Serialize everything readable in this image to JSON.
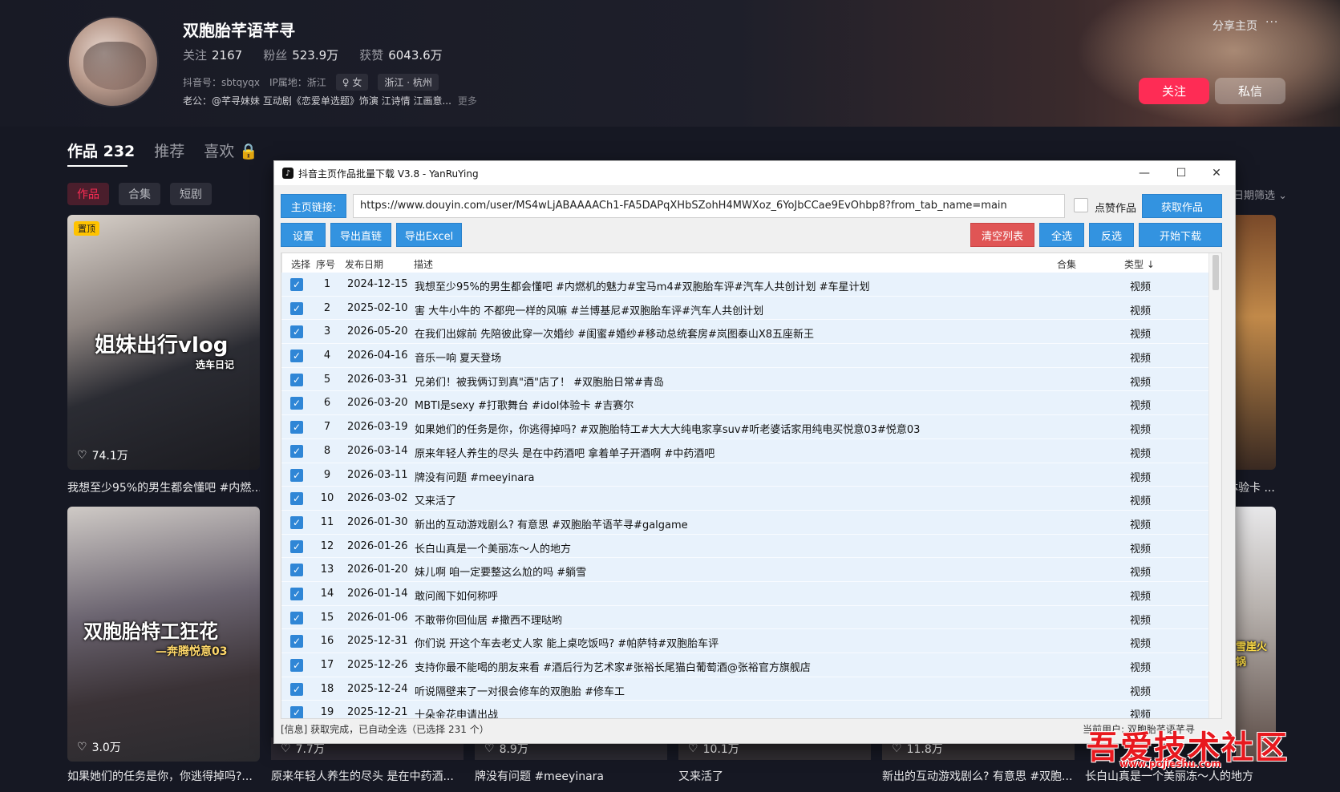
{
  "profile": {
    "name": "双胞胎芊语芊寻",
    "follow_label": "关注",
    "follow_count": "2167",
    "fans_label": "粉丝",
    "fans_count": "523.9万",
    "likes_label": "获赞",
    "likes_count": "6043.6万",
    "douyin_id": "抖音号：sbtqyqx",
    "ip": "IP属地：浙江",
    "gender_tag": "♀ 女",
    "location_tag": "浙江 · 杭州",
    "bio": "老公：@芊寻妹妹 互动剧《恋爱单选题》饰演 江诗情 江画意...",
    "bio_more": "更多",
    "share": "分享主页",
    "more_dots": "···",
    "follow_btn": "关注",
    "message_btn": "私信"
  },
  "tabs": {
    "works": "作品 232",
    "recommend": "推荐",
    "favorites": "喜欢 🔒",
    "sub": [
      "作品",
      "合集",
      "短剧"
    ],
    "date_filter": "日期筛选 ⌄"
  },
  "cards": [
    {
      "likes": "74.1万",
      "title": "我想至少95%的男生都会懂吧 #内燃...",
      "pin": "置顶",
      "overlay": "姐妹出行vlog",
      "overlay_sub": "选车日记"
    },
    {
      "likes": "3.0万",
      "title": "如果她们的任务是你，你逃得掉吗?...",
      "overlay": "双胞胎特工狂花",
      "overlay_sub": "—奔腾悦意03"
    },
    {
      "likes": "7.7万",
      "title": "原来年轻人养生的尽头 是在中药酒..."
    },
    {
      "likes": "8.9万",
      "title": "牌没有问题 #meeyinara"
    },
    {
      "likes": "10.1万",
      "title": "又来活了"
    },
    {
      "likes": "11.8万",
      "title": "新出的互动游戏剧么? 有意思 #双胞..."
    },
    {
      "likes": "",
      "title": "长白山真是一个美丽冻～人的地方",
      "overlay": "雪崖火锅"
    },
    {
      "likes": "",
      "title": "体验卡 ..."
    }
  ],
  "window": {
    "title": "抖音主页作品批量下载 V3.8 - YanRuYing",
    "icon": "♪",
    "controls": {
      "minimize": "—",
      "maximize": "☐",
      "close": "✕"
    },
    "url_label": "主页链接:",
    "url_value": "https://www.douyin.com/user/MS4wLjABAAAACh1-FA5DAPqXHbSZohH4MWXoz_6YoJbCCae9EvOhbp8?from_tab_name=main",
    "like_works_label": "点赞作品",
    "fetch_btn": "获取作品",
    "settings_btn": "设置",
    "export_links_btn": "导出直链",
    "export_excel_btn": "导出Excel",
    "clear_btn": "清空列表",
    "select_all_btn": "全选",
    "invert_btn": "反选",
    "download_btn": "开始下载",
    "columns": {
      "select": "选择",
      "no": "序号",
      "date": "发布日期",
      "desc": "描述",
      "collection": "合集",
      "type": "类型 ↓"
    },
    "rows": [
      {
        "no": "1",
        "date": "2024-12-15",
        "desc": "我想至少95%的男生都会懂吧 #内燃机的魅力#宝马m4#双胞胎车评#汽车人共创计划 #车星计划",
        "type": "视频"
      },
      {
        "no": "2",
        "date": "2025-02-10",
        "desc": "害 大牛小牛的 不都兜一样的风嘛 #兰博基尼#双胞胎车评#汽车人共创计划",
        "type": "视频"
      },
      {
        "no": "3",
        "date": "2026-05-20",
        "desc": "在我们出嫁前 先陪彼此穿一次婚纱 #闺蜜#婚纱#移动总统套房#岚图泰山X8五座新王",
        "type": "视频"
      },
      {
        "no": "4",
        "date": "2026-04-16",
        "desc": "音乐一响 夏天登场",
        "type": "视频"
      },
      {
        "no": "5",
        "date": "2026-03-31",
        "desc": "兄弟们！被我俩订到真\"酒\"店了！ #双胞胎日常#青岛",
        "type": "视频"
      },
      {
        "no": "6",
        "date": "2026-03-20",
        "desc": "MBTI是sexy #打歌舞台 #idol体验卡 #吉赛尔",
        "type": "视频"
      },
      {
        "no": "7",
        "date": "2026-03-19",
        "desc": "如果她们的任务是你，你逃得掉吗? #双胞胎特工#大大大纯电家享suv#听老婆话家用纯电买悦意03#悦意03",
        "type": "视频"
      },
      {
        "no": "8",
        "date": "2026-03-14",
        "desc": "原来年轻人养生的尽头 是在中药酒吧 拿着单子开酒啊 #中药酒吧",
        "type": "视频"
      },
      {
        "no": "9",
        "date": "2026-03-11",
        "desc": "牌没有问题 #meeyinara",
        "type": "视频"
      },
      {
        "no": "10",
        "date": "2026-03-02",
        "desc": "又来活了",
        "type": "视频"
      },
      {
        "no": "11",
        "date": "2026-01-30",
        "desc": "新出的互动游戏剧么? 有意思 #双胞胎芊语芊寻#galgame",
        "type": "视频"
      },
      {
        "no": "12",
        "date": "2026-01-26",
        "desc": "长白山真是一个美丽冻～人的地方",
        "type": "视频"
      },
      {
        "no": "13",
        "date": "2026-01-20",
        "desc": "妹儿啊 咱一定要整这么尬的吗 #躺雪",
        "type": "视频"
      },
      {
        "no": "14",
        "date": "2026-01-14",
        "desc": "敢问阁下如何称呼",
        "type": "视频"
      },
      {
        "no": "15",
        "date": "2026-01-06",
        "desc": "不敢带你回仙居 #撒西不理哒哟",
        "type": "视频"
      },
      {
        "no": "16",
        "date": "2025-12-31",
        "desc": "你们说 开这个车去老丈人家 能上桌吃饭吗? #帕萨特#双胞胎车评",
        "type": "视频"
      },
      {
        "no": "17",
        "date": "2025-12-26",
        "desc": "支持你最不能喝的朋友来看 #酒后行为艺术家#张裕长尾猫白葡萄酒@张裕官方旗舰店",
        "type": "视频"
      },
      {
        "no": "18",
        "date": "2025-12-24",
        "desc": "听说隔壁来了一对很会修车的双胞胎 #修车工",
        "type": "视频"
      },
      {
        "no": "19",
        "date": "2025-12-21",
        "desc": "十朵金花申请出战",
        "type": "视频"
      }
    ],
    "status": "[信息] 获取完成，已自动全选（已选择 231 个）",
    "status_right": "当前用户: 双胞胎芊语芊寻"
  },
  "watermark": {
    "text": "吾爱技术社区",
    "url": "www.pojieshu.com"
  }
}
